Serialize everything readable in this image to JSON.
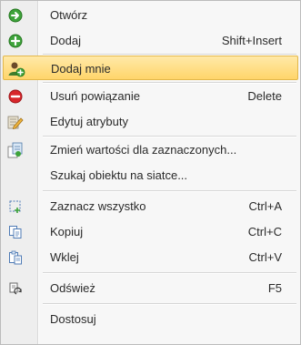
{
  "menu": {
    "items": [
      {
        "label": "Otwórz",
        "shortcut": "",
        "icon": "open-arrow-icon"
      },
      {
        "label": "Dodaj",
        "shortcut": "Shift+Insert",
        "icon": "add-icon"
      },
      {
        "label": "Dodaj mnie",
        "shortcut": "",
        "icon": "add-me-icon"
      },
      {
        "label": "Usuń powiązanie",
        "shortcut": "Delete",
        "icon": "remove-icon"
      },
      {
        "label": "Edytuj atrybuty",
        "shortcut": "",
        "icon": "edit-icon"
      },
      {
        "label": "Zmień wartości dla zaznaczonych...",
        "shortcut": "",
        "icon": "change-values-icon"
      },
      {
        "label": "Szukaj obiektu na siatce...",
        "shortcut": "",
        "icon": ""
      },
      {
        "label": "Zaznacz wszystko",
        "shortcut": "Ctrl+A",
        "icon": "select-all-icon"
      },
      {
        "label": "Kopiuj",
        "shortcut": "Ctrl+C",
        "icon": "copy-icon"
      },
      {
        "label": "Wklej",
        "shortcut": "Ctrl+V",
        "icon": "paste-icon"
      },
      {
        "label": "Odśwież",
        "shortcut": "F5",
        "icon": "refresh-icon"
      },
      {
        "label": "Dostosuj",
        "shortcut": "",
        "icon": ""
      }
    ],
    "highlighted_item": "Dodaj mnie",
    "colors": {
      "highlight": "#ffd56a",
      "green_icon": "#3ea33b",
      "red_icon": "#d8262b"
    }
  }
}
